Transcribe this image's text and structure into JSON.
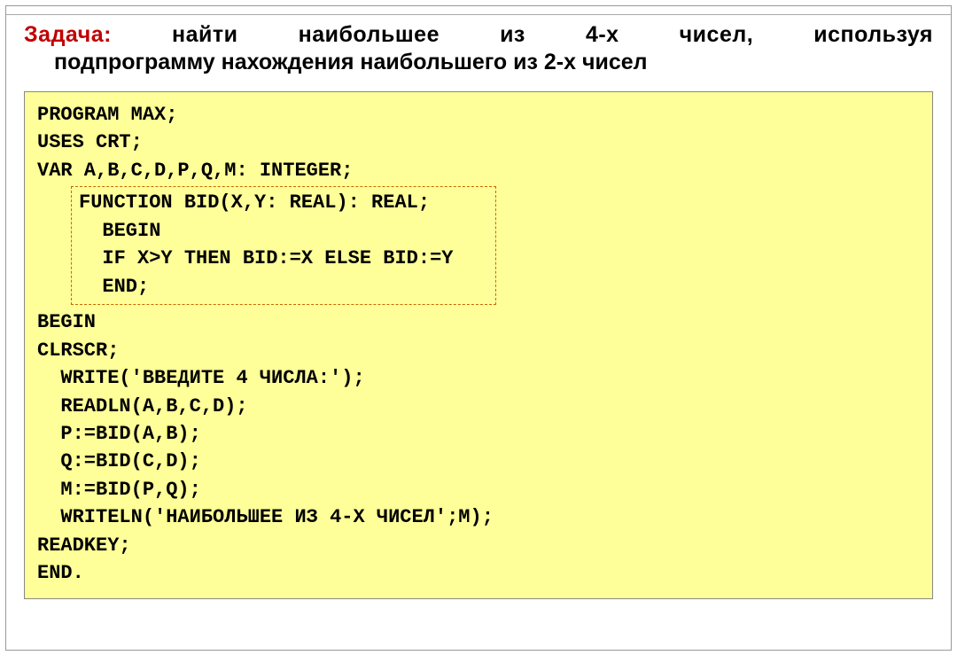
{
  "task": {
    "label": "Задача:",
    "line1_rest": " найти наибольшее из 4-х чисел, используя",
    "line2": "подпрограмму нахождения наибольшего из 2-х чисел"
  },
  "code": {
    "l01_kw": "PROGRAM",
    "l01_rest": " MAX;",
    "l02_kw": "USES",
    "l02_rest": " CRT;",
    "l03_kw": "VAR",
    "l03_rest": " A,B,C,D,P,Q,M: INTEGER;",
    "fn": {
      "l1_kw": "FUNCTION",
      "l1_rest": " BID(X,Y: REAL): REAL;",
      "l2": "  BEGIN",
      "l3": "  IF X>Y THEN BID:=X ELSE BID:=Y",
      "l4": "  END;"
    },
    "l04": "BEGIN",
    "l05": "CLRSCR;",
    "l06_kw": "  WRITE",
    "l06_rest": "('ВВЕДИТЕ 4 ЧИСЛА:');",
    "l07": "  READLN(A,B,C,D);",
    "l08": "  P:=BID(A,B);",
    "l09": "  Q:=BID(C,D);",
    "l10": "  M:=BID(P,Q);",
    "l11_kw": "  WRITELN",
    "l11_rest": "('НАИБОЛЬШЕЕ ИЗ 4-Х ЧИСЕЛ';M);",
    "l12": "READKEY;",
    "l13": "END."
  }
}
